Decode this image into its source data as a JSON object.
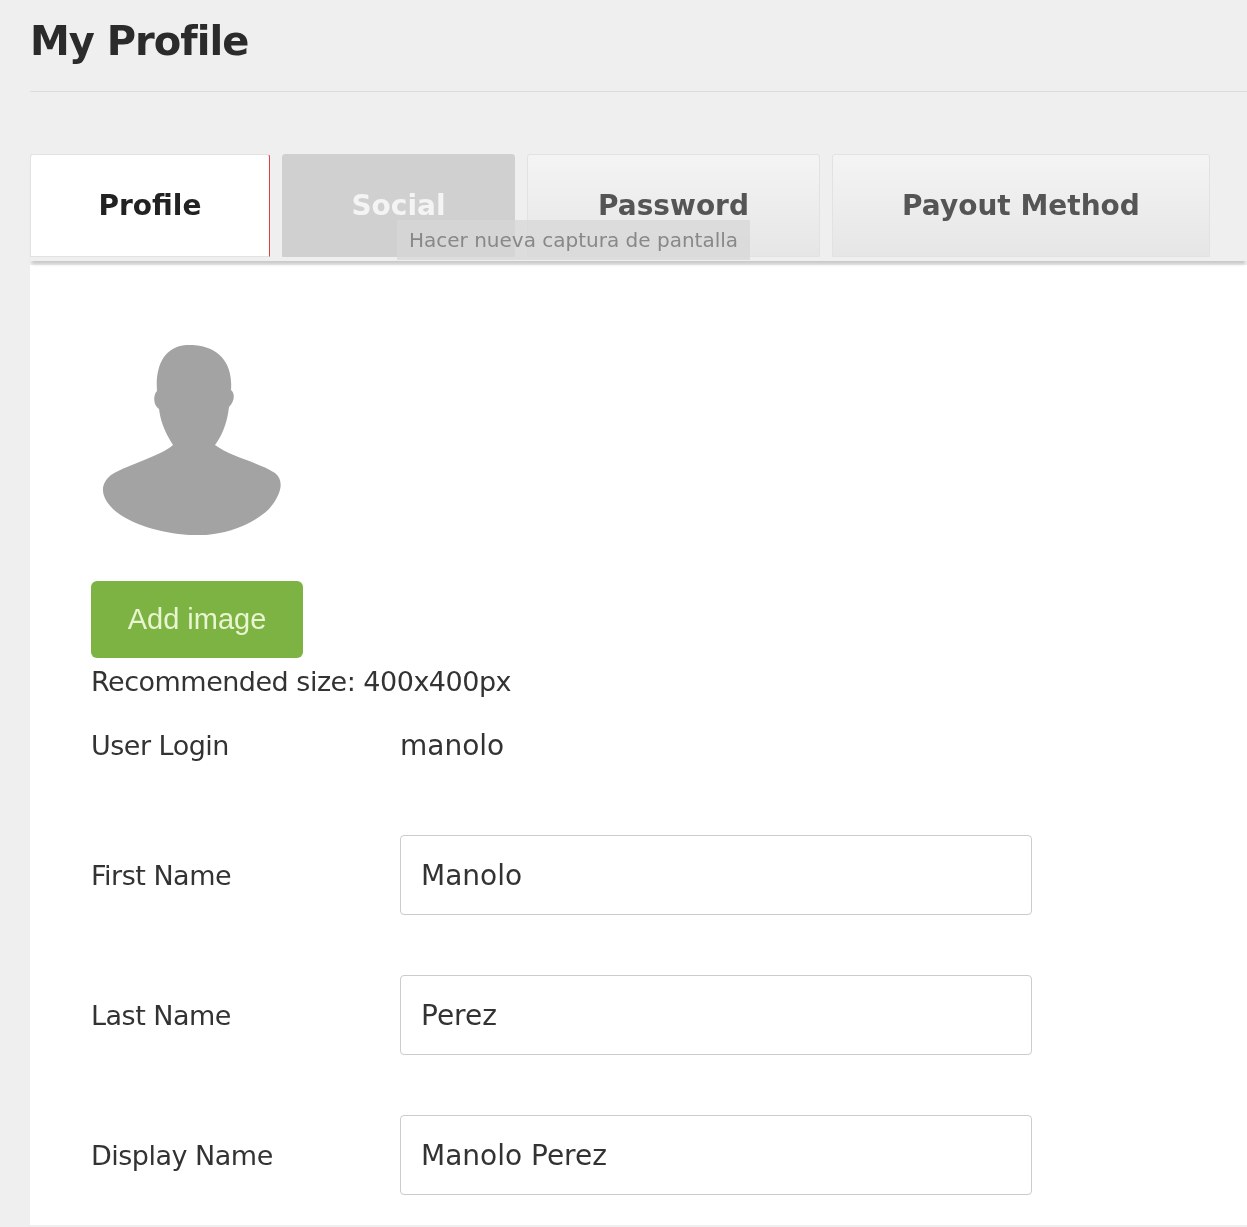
{
  "page": {
    "title": "My Profile"
  },
  "tabs": [
    {
      "label": "Profile",
      "selected": true,
      "hovered": false
    },
    {
      "label": "Social",
      "selected": false,
      "hovered": true
    },
    {
      "label": "Password",
      "selected": false,
      "hovered": false
    },
    {
      "label": "Payout Method",
      "selected": false,
      "hovered": false
    }
  ],
  "tooltip": {
    "text": "Hacer nueva captura de pantalla"
  },
  "avatar": {
    "button": "Add image",
    "hint": "Recommended size: 400x400px"
  },
  "fields": [
    {
      "label": "User Login",
      "kind": "static",
      "value": "manolo"
    },
    {
      "label": "First Name",
      "kind": "input",
      "value": "Manolo"
    },
    {
      "label": "Last Name",
      "kind": "input",
      "value": "Perez"
    },
    {
      "label": "Display Name",
      "kind": "input",
      "value": "Manolo Perez"
    }
  ]
}
